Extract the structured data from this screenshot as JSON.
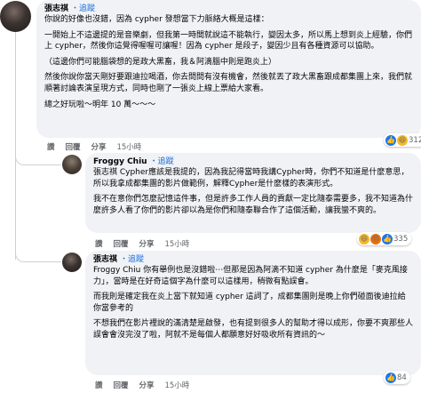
{
  "colors": {
    "accent": "#216fdb",
    "bubble": "#f0f2f5",
    "meta": "#65676b"
  },
  "comments": [
    {
      "author": "張志祺",
      "follow": "・追蹤",
      "paragraphs": [
        "你說的好像也沒錯，因為 cypher 發想當下力脈絡大概是這樣：",
        "一開始上不這邊提的是音樂劇，但我第一時間就說這不能執行，變因太多，所以馬上想到炎上經驗，你們上 cypher，然後你這覺得喔喔可讓喔！因為 cypher 是段子，變因少且有各種資源可以協助。",
        "（這邊你們可能腦袋想的是政大黑畜，我＆阿滴腦中則是跑炎上）",
        "然後你說你當天剛好要跟迪拉喝酒，你去問問有沒有機會，然後就丟了政大黑畜跟成都集團上來，我們就順著討論表演呈現方式，同時也剛了一張炎上線上票給大家看。",
        "總之好玩啦～明年 10 萬～～～"
      ],
      "reaction_count": "312",
      "actions": [
        "讚",
        "回覆",
        "分享"
      ],
      "time": "15小時"
    },
    {
      "author": "Froggy Chiu",
      "follow": "・追蹤",
      "paragraphs": [
        "張志祺 Cypher應該是我提的，因為我記得當時我講Cypher時，你們不知道是什麼意思，所以我拿成都集團的影片做範例，解釋Cypher是什麼樣的表演形式。",
        "我不在意你們怎麼記憶這件事，但是許多工作人員的貢獻一定比隨泰需要多，我不知道為什麼許多人看了你們的影片卻以為是你們和隨泰聯合作了這個活動，讓我蠻不爽的。"
      ],
      "reaction_count": "335",
      "actions": [
        "讚",
        "回覆",
        "分享"
      ],
      "time": "15小時"
    },
    {
      "author": "張志祺",
      "follow": "・追蹤",
      "paragraphs": [
        "Froggy Chiu 你有舉例也是沒錯啦⋯但那是因為阿滴不知道 cypher 為什麼是「麥克風接力」，當時是在好奇這個字為什麼可以這樣用，稍微有點誤會。",
        "而我則是確定我在炎上當下就知道 cypher 這詞了，成都集團則是晚上你們碰面後迪拉給你當參考的",
        "不想我們在影片裡說的滿清楚是啟發，也有提到很多人的幫助才得以成形，你要不爽那些人誤會會沒完沒了啦，阿就不是每個人都願意好好吸收所有資訊的～"
      ],
      "reaction_count": "84",
      "actions": [
        "讚",
        "回覆",
        "分享"
      ],
      "time": "15小時"
    }
  ]
}
